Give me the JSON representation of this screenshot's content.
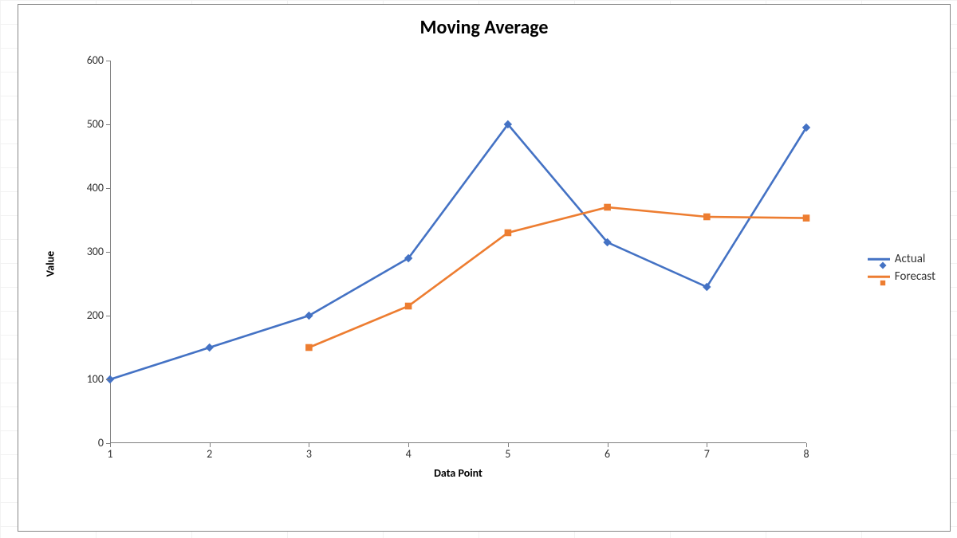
{
  "chart_data": {
    "type": "line",
    "title": "Moving Average",
    "xlabel": "Data Point",
    "ylabel": "Value",
    "categories": [
      1,
      2,
      3,
      4,
      5,
      6,
      7,
      8
    ],
    "ylim": [
      0,
      600
    ],
    "y_ticks": [
      0,
      100,
      200,
      300,
      400,
      500,
      600
    ],
    "series": [
      {
        "name": "Actual",
        "color": "#4472C4",
        "marker": "diamond",
        "values": [
          100,
          150,
          200,
          290,
          500,
          315,
          245,
          495
        ]
      },
      {
        "name": "Forecast",
        "color": "#ED7D31",
        "marker": "square",
        "values": [
          null,
          null,
          150,
          215,
          330,
          370,
          355,
          353
        ]
      }
    ]
  },
  "legend": {
    "items": [
      "Actual",
      "Forecast"
    ]
  }
}
